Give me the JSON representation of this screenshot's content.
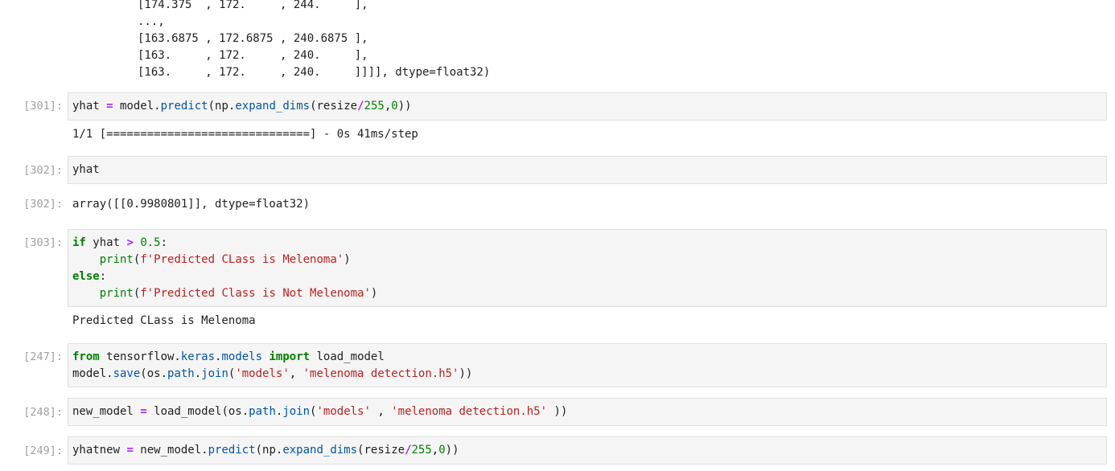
{
  "top_output": {
    "lines": [
      "[174.375  , 172.     , 244.     ],",
      "...,",
      "[163.6875 , 172.6875 , 240.6875 ],",
      "[163.     , 172.     , 240.     ],",
      "[163.     , 172.     , 240.     ]]]], dtype=float32)"
    ]
  },
  "cells": {
    "c301": {
      "in_prompt": "[301]:",
      "code": {
        "t1": "yhat ",
        "t2": "=",
        "t3": " model.",
        "t4": "predict",
        "t5": "(np.",
        "t6": "expand_dims",
        "t7": "(resize",
        "t8": "/",
        "t9": "255",
        "t10": ",",
        "t11": "0",
        "t12": "))"
      },
      "output": "1/1 [==============================] - 0s 41ms/step"
    },
    "c302": {
      "in_prompt": "[302]:",
      "code": "yhat",
      "out_prompt": "[302]:",
      "output": "array([[0.9980801]], dtype=float32)"
    },
    "c303": {
      "in_prompt": "[303]:",
      "l1": {
        "kw": "if",
        "a": " yhat ",
        "op": ">",
        "b": " ",
        "num": "0.5",
        "c": ":"
      },
      "l2": {
        "indent": "    ",
        "fn": "print",
        "a": "(",
        "str": "f'Predicted CLass is Melenoma'",
        "b": ")"
      },
      "l3": {
        "kw": "else",
        "a": ":"
      },
      "l4": {
        "indent": "    ",
        "fn": "print",
        "a": "(",
        "str": "f'Predicted Class is Not Melenoma'",
        "b": ")"
      },
      "output": "Predicted CLass is Melenoma"
    },
    "c247": {
      "in_prompt": "[247]:",
      "l1": {
        "kw1": "from",
        "a": " tensorflow.",
        "m1": "keras",
        "b": ".",
        "m2": "models",
        "c": " ",
        "kw2": "import",
        "d": " load_model"
      },
      "l2": {
        "a": "model.",
        "fn": "save",
        "b": "(os.",
        "m": "path",
        "c": ".",
        "fn2": "join",
        "d": "(",
        "s1": "'models'",
        "e": ", ",
        "s2": "'melenoma detection.h5'",
        "f": "))"
      }
    },
    "c248": {
      "in_prompt": "[248]:",
      "l1": {
        "a": "new_model ",
        "op": "=",
        "b": " load_model(os.",
        "m": "path",
        "c": ".",
        "fn": "join",
        "d": "(",
        "s1": "'models'",
        "e": " , ",
        "s2": "'melenoma detection.h5'",
        "f": " ))"
      }
    },
    "c249": {
      "in_prompt": "[249]:",
      "l1": {
        "a": "yhatnew ",
        "op": "=",
        "b": " new_model.",
        "fn": "predict",
        "c": "(np.",
        "fn2": "expand_dims",
        "d": "(resize",
        "op2": "/",
        "n1": "255",
        "e": ",",
        "n2": "0",
        "f": "))"
      }
    }
  },
  "colors": {
    "prompt": "#a0a0a0",
    "cell_bg": "#f5f5f5",
    "keyword": "#008000",
    "operator": "#aa22ff",
    "string": "#ba2121",
    "attribute": "#0055aa"
  }
}
